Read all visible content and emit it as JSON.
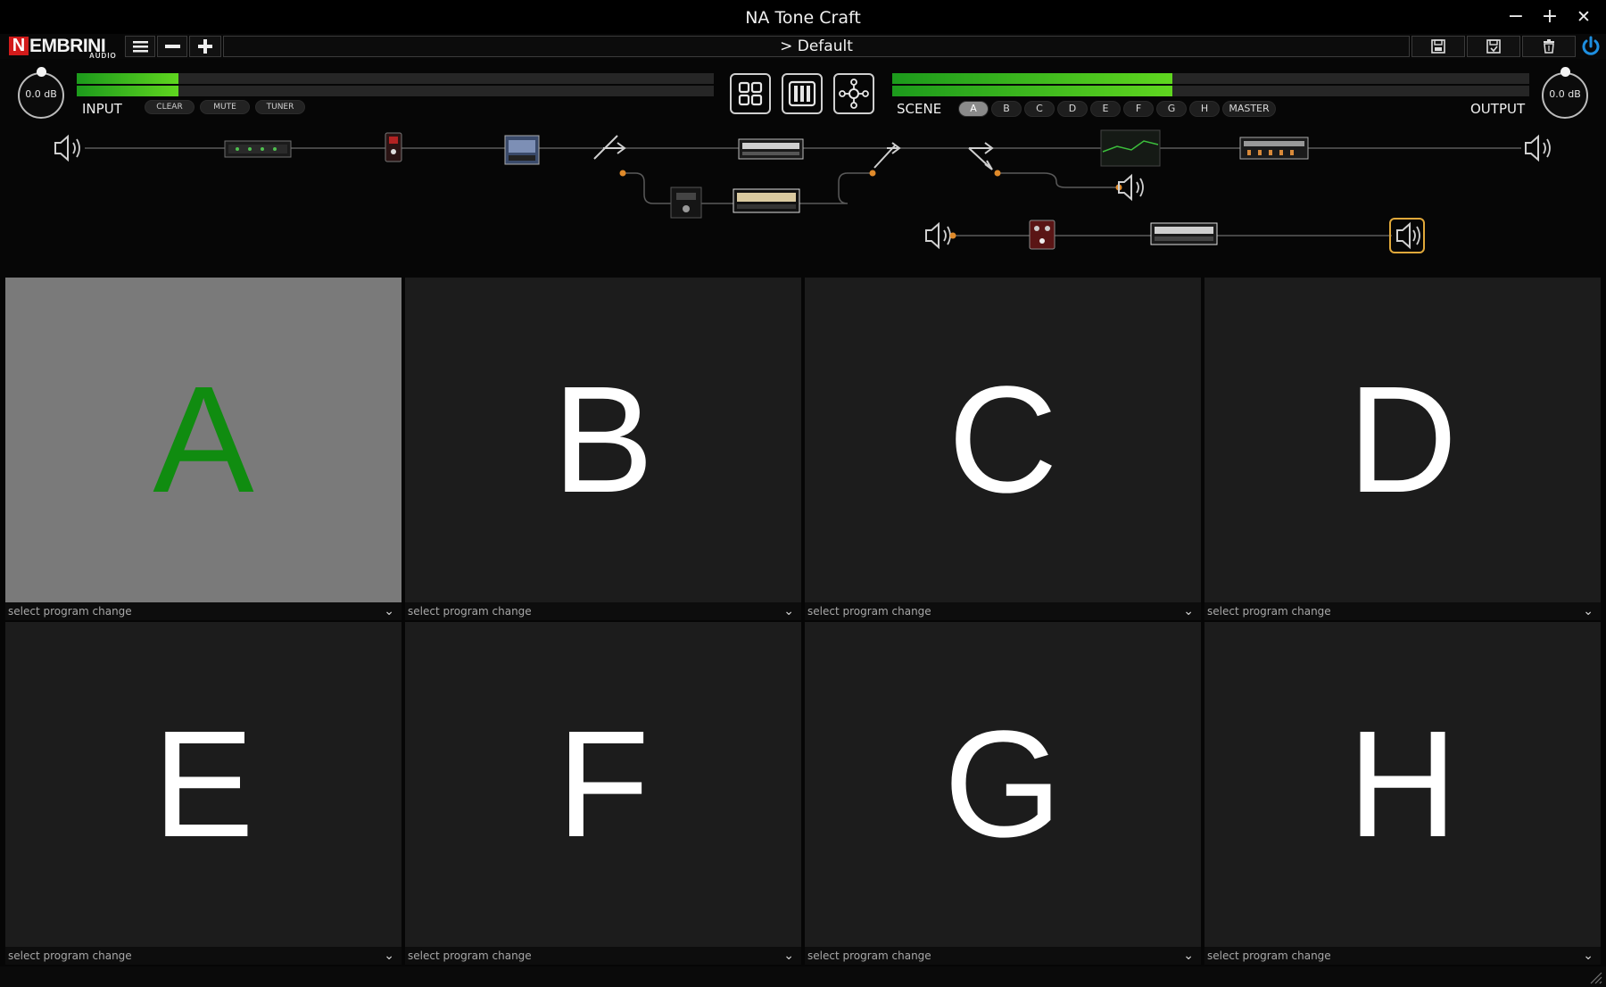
{
  "window": {
    "title": "NA Tone Craft",
    "minimize_label": "−",
    "maximize_label": "+",
    "close_label": "✕"
  },
  "logo": {
    "brand": "NEMBRINI",
    "sub": "AUDIO"
  },
  "preset": {
    "name": "> Default"
  },
  "input": {
    "label": "INPUT",
    "gain": "0.0 dB",
    "meter_level": 0.16,
    "buttons": [
      "CLEAR",
      "MUTE",
      "TUNER"
    ]
  },
  "output": {
    "label": "OUTPUT",
    "gain": "0.0 dB",
    "meter_level": 0.44
  },
  "scene_bar": {
    "label": "SCENE",
    "scenes": [
      "A",
      "B",
      "C",
      "D",
      "E",
      "F",
      "G",
      "H"
    ],
    "master_label": "MASTER",
    "active": "A"
  },
  "scenes": [
    {
      "letter": "A",
      "pc": "select program change",
      "active": true
    },
    {
      "letter": "B",
      "pc": "select program change",
      "active": false
    },
    {
      "letter": "C",
      "pc": "select program change",
      "active": false
    },
    {
      "letter": "D",
      "pc": "select program change",
      "active": false
    },
    {
      "letter": "E",
      "pc": "select program change",
      "active": false
    },
    {
      "letter": "F",
      "pc": "select program change",
      "active": false
    },
    {
      "letter": "G",
      "pc": "select program change",
      "active": false
    },
    {
      "letter": "H",
      "pc": "select program change",
      "active": false
    }
  ],
  "colors": {
    "accent_green": "#108c10",
    "meter_green": "#4ec41f",
    "chain_orange": "#e08a2a",
    "power_blue": "#1e8fe0"
  }
}
